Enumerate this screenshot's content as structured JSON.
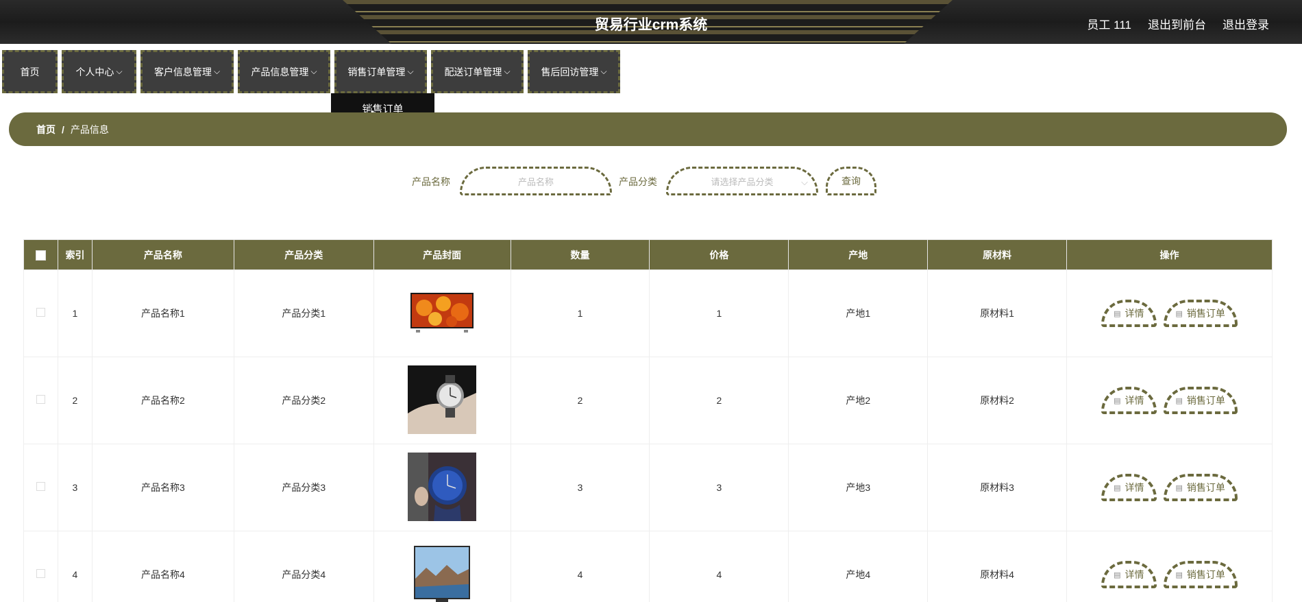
{
  "header": {
    "title": "贸易行业crm系统",
    "user": "员工 111",
    "to_front": "退出到前台",
    "logout": "退出登录"
  },
  "nav": {
    "items": [
      {
        "label": "首页",
        "has_dropdown": false
      },
      {
        "label": "个人中心",
        "has_dropdown": true
      },
      {
        "label": "客户信息管理",
        "has_dropdown": true
      },
      {
        "label": "产品信息管理",
        "has_dropdown": true
      },
      {
        "label": "销售订单管理",
        "has_dropdown": true
      },
      {
        "label": "配送订单管理",
        "has_dropdown": true
      },
      {
        "label": "售后回访管理",
        "has_dropdown": true
      }
    ],
    "open_dropdown": {
      "parent": "销售订单管理",
      "items": [
        "销售订单"
      ]
    }
  },
  "breadcrumb": {
    "home": "首页",
    "separator": "/",
    "current": "产品信息"
  },
  "search": {
    "name_label": "产品名称",
    "name_placeholder": "产品名称",
    "category_label": "产品分类",
    "category_placeholder": "请选择产品分类",
    "query_button": "查询"
  },
  "table": {
    "columns": [
      "索引",
      "产品名称",
      "产品分类",
      "产品封面",
      "数量",
      "价格",
      "产地",
      "原材料",
      "操作"
    ],
    "rows": [
      {
        "index": "1",
        "name": "产品名称1",
        "category": "产品分类1",
        "cover": "tv-flowers",
        "quantity": "1",
        "price": "1",
        "origin": "产地1",
        "material": "原材料1"
      },
      {
        "index": "2",
        "name": "产品名称2",
        "category": "产品分类2",
        "cover": "wristwatch-dark",
        "quantity": "2",
        "price": "2",
        "origin": "产地2",
        "material": "原材料2"
      },
      {
        "index": "3",
        "name": "产品名称3",
        "category": "产品分类3",
        "cover": "wristwatch-blue",
        "quantity": "3",
        "price": "3",
        "origin": "产地3",
        "material": "原材料3"
      },
      {
        "index": "4",
        "name": "产品名称4",
        "category": "产品分类4",
        "cover": "tv-landscape",
        "quantity": "4",
        "price": "4",
        "origin": "产地4",
        "material": "原材料4"
      }
    ],
    "actions": {
      "detail": "详情",
      "order": "销售订单"
    }
  },
  "colors": {
    "accent": "#6b6a3e",
    "header_bg": "#1c1c1c",
    "nav_bg": "#3d3d3d"
  }
}
